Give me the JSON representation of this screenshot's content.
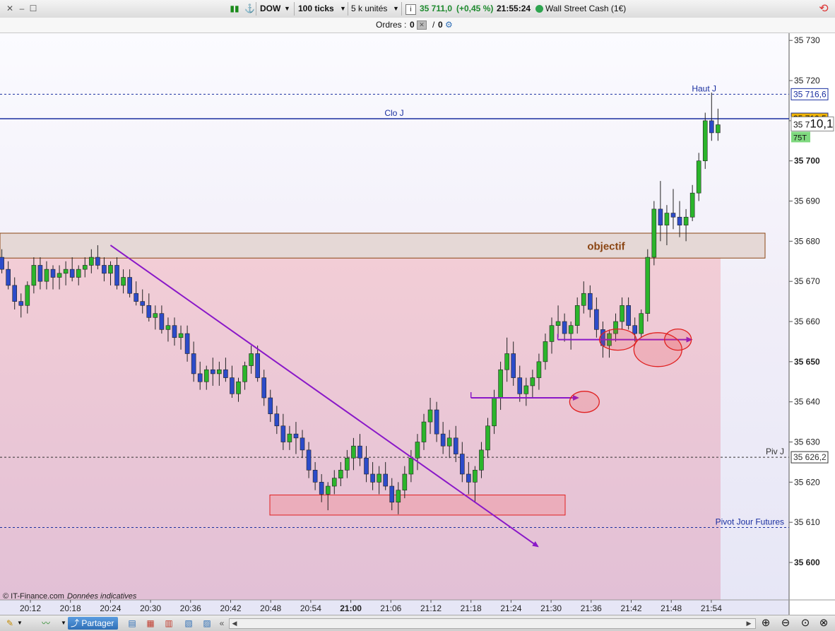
{
  "toolbar": {
    "symbol": "DOW",
    "interval": "100 ticks",
    "size": "5 k unités",
    "info_icon": "info-icon",
    "price": "35 711,0",
    "change": "(+0,45 %)",
    "time": "21:55:24",
    "instrument": "Wall Street Cash (1€)",
    "status_color": "#2ea44f"
  },
  "orders": {
    "label": "Ordres :",
    "count1": "0",
    "slash": "/",
    "count2": "0"
  },
  "footer": {
    "copyright": "© IT-Finance.com",
    "disclaimer": "Données indicatives",
    "share_label": "Partager"
  },
  "chart_data": {
    "type": "candlestick",
    "title": "",
    "ylim": [
      35592,
      35733
    ],
    "y_ticks": [
      35600,
      35610,
      35620,
      35630,
      35640,
      35650,
      35660,
      35670,
      35680,
      35690,
      35700,
      35710,
      35720,
      35730
    ],
    "y_tick_labels": [
      "35 600",
      "35 610",
      "35 620",
      "35 630",
      "35 640",
      "35 650",
      "35 660",
      "35 670",
      "35 680",
      "35 690",
      "35 700",
      "35 710",
      "35 720",
      "35 730"
    ],
    "bold_y_ticks": [
      35600,
      35650,
      35700
    ],
    "x_tick_labels": [
      "20:12",
      "20:18",
      "20:24",
      "20:30",
      "20:36",
      "20:42",
      "20:48",
      "20:54",
      "21:00",
      "21:06",
      "21:12",
      "21:18",
      "21:24",
      "21:30",
      "21:36",
      "21:42",
      "21:48",
      "21:54"
    ],
    "bold_x_tick": "21:00",
    "up_color": "#2bb52b",
    "down_color": "#2c4bc9",
    "levels": [
      {
        "name": "Haut J",
        "value": 35716.6,
        "label": "35 716,6",
        "style": "dashed",
        "color": "#1a2fa0"
      },
      {
        "name": "Clo J",
        "value": 35710.5,
        "label": "35 710,5",
        "style": "solid",
        "color": "#1a2fa0",
        "badge": "#f0b400"
      },
      {
        "name": "Piv J",
        "value": 35626.2,
        "label": "35 626,2",
        "style": "dashed",
        "color": "#333333"
      },
      {
        "name": "Pivot Jour Futures",
        "value": 35608.7,
        "label": "",
        "style": "dashed",
        "color": "#1a2fa0"
      }
    ],
    "current_price": {
      "text_small": "35 7",
      "text_big": "10,1",
      "value": 35709.2
    },
    "tick_count_label": "75T",
    "zone_objectif": {
      "label": "objectif",
      "y_top": 35682,
      "y_bottom": 35675.8
    },
    "support_zone": {
      "y_top": 35616.8,
      "y_bottom": 35611.8
    },
    "trendline": {
      "from": {
        "x": "20:24",
        "y": 35679
      },
      "to": {
        "x": "21:28",
        "y": 35604
      }
    },
    "arrows": [
      {
        "from": {
          "x": "21:18",
          "y": 35641
        },
        "to": {
          "x": "21:34",
          "y": 35641
        }
      },
      {
        "from": {
          "x": "21:31",
          "y": 35655.5
        },
        "to": {
          "x": "21:51",
          "y": 35655.5
        }
      }
    ],
    "circles": [
      {
        "x": "21:35",
        "y": 35640
      },
      {
        "x": "21:40",
        "y": 35655.5
      },
      {
        "x": "21:46",
        "y": 35653
      },
      {
        "x": "21:49",
        "y": 35655.5
      }
    ],
    "candles": [
      {
        "o": 35674.5,
        "h": 35677,
        "l": 35672,
        "c": 35673,
        "x": "20:06"
      },
      {
        "o": 35673,
        "h": 35676,
        "l": 35671,
        "c": 35675,
        "x": "20:06"
      },
      {
        "o": 35675,
        "h": 35678,
        "l": 35672,
        "c": 35676,
        "x": "20:07"
      },
      {
        "o": 35676,
        "h": 35679,
        "l": 35674,
        "c": 35677,
        "x": "20:07"
      },
      {
        "o": 35677,
        "h": 35679,
        "l": 35673,
        "c": 35674,
        "x": "20:08"
      },
      {
        "o": 35674,
        "h": 35677,
        "l": 35671,
        "c": 35676,
        "x": "20:08"
      },
      {
        "o": 35676,
        "h": 35678,
        "l": 35672,
        "c": 35673,
        "x": "20:09"
      },
      {
        "o": 35673,
        "h": 35675,
        "l": 35668,
        "c": 35669,
        "x": "20:09"
      },
      {
        "o": 35669,
        "h": 35671,
        "l": 35663,
        "c": 35665,
        "x": "20:10"
      },
      {
        "o": 35665,
        "h": 35667,
        "l": 35661,
        "c": 35664,
        "x": "20:10"
      },
      {
        "o": 35664,
        "h": 35670,
        "l": 35662,
        "c": 35669,
        "x": "20:11"
      },
      {
        "o": 35669,
        "h": 35676,
        "l": 35667,
        "c": 35674,
        "x": "20:12"
      },
      {
        "o": 35674,
        "h": 35676,
        "l": 35668,
        "c": 35670,
        "x": "20:12"
      },
      {
        "o": 35670,
        "h": 35675,
        "l": 35668,
        "c": 35673,
        "x": "20:13"
      },
      {
        "o": 35673,
        "h": 35674,
        "l": 35668,
        "c": 35671,
        "x": "20:14"
      },
      {
        "o": 35671,
        "h": 35674,
        "l": 35668,
        "c": 35672,
        "x": "20:15"
      },
      {
        "o": 35672,
        "h": 35675,
        "l": 35669,
        "c": 35673,
        "x": "20:16"
      },
      {
        "o": 35673,
        "h": 35676,
        "l": 35670,
        "c": 35671,
        "x": "20:17"
      },
      {
        "o": 35671,
        "h": 35674,
        "l": 35669,
        "c": 35673,
        "x": "20:18"
      },
      {
        "o": 35673,
        "h": 35676,
        "l": 35671,
        "c": 35674,
        "x": "20:19"
      },
      {
        "o": 35674,
        "h": 35678,
        "l": 35672,
        "c": 35676,
        "x": "20:20"
      },
      {
        "o": 35676,
        "h": 35679,
        "l": 35673,
        "c": 35674,
        "x": "20:21"
      },
      {
        "o": 35674,
        "h": 35676,
        "l": 35670,
        "c": 35672,
        "x": "20:22"
      },
      {
        "o": 35672,
        "h": 35675,
        "l": 35669,
        "c": 35674,
        "x": "20:23"
      },
      {
        "o": 35674,
        "h": 35676,
        "l": 35668,
        "c": 35669,
        "x": "20:24"
      },
      {
        "o": 35669,
        "h": 35673,
        "l": 35667,
        "c": 35671,
        "x": "20:25"
      },
      {
        "o": 35671,
        "h": 35673,
        "l": 35666,
        "c": 35667,
        "x": "20:26"
      },
      {
        "o": 35667,
        "h": 35670,
        "l": 35664,
        "c": 35665,
        "x": "20:27"
      },
      {
        "o": 35665,
        "h": 35668,
        "l": 35662,
        "c": 35664,
        "x": "20:28"
      },
      {
        "o": 35664,
        "h": 35667,
        "l": 35660,
        "c": 35661,
        "x": "20:29"
      },
      {
        "o": 35661,
        "h": 35664,
        "l": 35658,
        "c": 35662,
        "x": "20:30"
      },
      {
        "o": 35662,
        "h": 35664,
        "l": 35657,
        "c": 35658,
        "x": "20:31"
      },
      {
        "o": 35658,
        "h": 35661,
        "l": 35655,
        "c": 35659,
        "x": "20:32"
      },
      {
        "o": 35659,
        "h": 35661,
        "l": 35654,
        "c": 35656,
        "x": "20:33"
      },
      {
        "o": 35656,
        "h": 35659,
        "l": 35653,
        "c": 35657,
        "x": "20:34"
      },
      {
        "o": 35657,
        "h": 35659,
        "l": 35650,
        "c": 35652,
        "x": "20:35"
      },
      {
        "o": 35652,
        "h": 35655,
        "l": 35645,
        "c": 35647,
        "x": "20:36"
      },
      {
        "o": 35647,
        "h": 35650,
        "l": 35643,
        "c": 35645,
        "x": "20:37"
      },
      {
        "o": 35645,
        "h": 35649,
        "l": 35643,
        "c": 35648,
        "x": "20:38"
      },
      {
        "o": 35648,
        "h": 35651,
        "l": 35644,
        "c": 35647,
        "x": "20:39"
      },
      {
        "o": 35647,
        "h": 35650,
        "l": 35644,
        "c": 35648,
        "x": "20:40"
      },
      {
        "o": 35648,
        "h": 35651,
        "l": 35645,
        "c": 35646,
        "x": "20:41"
      },
      {
        "o": 35646,
        "h": 35649,
        "l": 35641,
        "c": 35642,
        "x": "20:42"
      },
      {
        "o": 35642,
        "h": 35646,
        "l": 35640,
        "c": 35645,
        "x": "20:43"
      },
      {
        "o": 35645,
        "h": 35650,
        "l": 35643,
        "c": 35649,
        "x": "20:44"
      },
      {
        "o": 35649,
        "h": 35654,
        "l": 35647,
        "c": 35652,
        "x": "20:45"
      },
      {
        "o": 35652,
        "h": 35654,
        "l": 35645,
        "c": 35646,
        "x": "20:46"
      },
      {
        "o": 35646,
        "h": 35648,
        "l": 35639,
        "c": 35641,
        "x": "20:47"
      },
      {
        "o": 35641,
        "h": 35643,
        "l": 35635,
        "c": 35637,
        "x": "20:48"
      },
      {
        "o": 35637,
        "h": 35639,
        "l": 35632,
        "c": 35634,
        "x": "20:49"
      },
      {
        "o": 35634,
        "h": 35637,
        "l": 35628,
        "c": 35630,
        "x": "20:50"
      },
      {
        "o": 35630,
        "h": 35634,
        "l": 35628,
        "c": 35632,
        "x": "20:51"
      },
      {
        "o": 35632,
        "h": 35635,
        "l": 35627,
        "c": 35631,
        "x": "20:52"
      },
      {
        "o": 35631,
        "h": 35633,
        "l": 35626,
        "c": 35628,
        "x": "20:53"
      },
      {
        "o": 35628,
        "h": 35630,
        "l": 35621,
        "c": 35623,
        "x": "20:54"
      },
      {
        "o": 35623,
        "h": 35625,
        "l": 35618,
        "c": 35620,
        "x": "20:55"
      },
      {
        "o": 35620,
        "h": 35622,
        "l": 35615,
        "c": 35617,
        "x": "20:56"
      },
      {
        "o": 35617,
        "h": 35620,
        "l": 35613,
        "c": 35619,
        "x": "20:57"
      },
      {
        "o": 35619,
        "h": 35623,
        "l": 35617,
        "c": 35621,
        "x": "20:58"
      },
      {
        "o": 35621,
        "h": 35625,
        "l": 35619,
        "c": 35623,
        "x": "20:59"
      },
      {
        "o": 35623,
        "h": 35628,
        "l": 35621,
        "c": 35626,
        "x": "21:00"
      },
      {
        "o": 35626,
        "h": 35631,
        "l": 35623,
        "c": 35629,
        "x": "21:01"
      },
      {
        "o": 35629,
        "h": 35632,
        "l": 35624,
        "c": 35626,
        "x": "21:02"
      },
      {
        "o": 35626,
        "h": 35629,
        "l": 35620,
        "c": 35622,
        "x": "21:03"
      },
      {
        "o": 35622,
        "h": 35625,
        "l": 35618,
        "c": 35620,
        "x": "21:04"
      },
      {
        "o": 35620,
        "h": 35624,
        "l": 35617,
        "c": 35622,
        "x": "21:05"
      },
      {
        "o": 35622,
        "h": 35625,
        "l": 35618,
        "c": 35619,
        "x": "21:06"
      },
      {
        "o": 35619,
        "h": 35621,
        "l": 35613,
        "c": 35615,
        "x": "21:07"
      },
      {
        "o": 35615,
        "h": 35620,
        "l": 35612,
        "c": 35618,
        "x": "21:08"
      },
      {
        "o": 35618,
        "h": 35624,
        "l": 35616,
        "c": 35622,
        "x": "21:09"
      },
      {
        "o": 35622,
        "h": 35628,
        "l": 35620,
        "c": 35626,
        "x": "21:10"
      },
      {
        "o": 35626,
        "h": 35632,
        "l": 35623,
        "c": 35630,
        "x": "21:11"
      },
      {
        "o": 35630,
        "h": 35637,
        "l": 35628,
        "c": 35635,
        "x": "21:12"
      },
      {
        "o": 35635,
        "h": 35641,
        "l": 35632,
        "c": 35638,
        "x": "21:13"
      },
      {
        "o": 35638,
        "h": 35640,
        "l": 35630,
        "c": 35632,
        "x": "21:14"
      },
      {
        "o": 35632,
        "h": 35635,
        "l": 35627,
        "c": 35629,
        "x": "21:15"
      },
      {
        "o": 35629,
        "h": 35633,
        "l": 35626,
        "c": 35631,
        "x": "21:16"
      },
      {
        "o": 35631,
        "h": 35634,
        "l": 35625,
        "c": 35627,
        "x": "21:17"
      },
      {
        "o": 35627,
        "h": 35630,
        "l": 35620,
        "c": 35622,
        "x": "21:18"
      },
      {
        "o": 35622,
        "h": 35625,
        "l": 35617,
        "c": 35620,
        "x": "21:19"
      },
      {
        "o": 35620,
        "h": 35624,
        "l": 35615,
        "c": 35623,
        "x": "21:20"
      },
      {
        "o": 35623,
        "h": 35630,
        "l": 35621,
        "c": 35628,
        "x": "21:21"
      },
      {
        "o": 35628,
        "h": 35636,
        "l": 35626,
        "c": 35634,
        "x": "21:22"
      },
      {
        "o": 35634,
        "h": 35643,
        "l": 35632,
        "c": 35641,
        "x": "21:23"
      },
      {
        "o": 35641,
        "h": 35650,
        "l": 35638,
        "c": 35648,
        "x": "21:24"
      },
      {
        "o": 35648,
        "h": 35656,
        "l": 35645,
        "c": 35652,
        "x": "21:25"
      },
      {
        "o": 35652,
        "h": 35655,
        "l": 35644,
        "c": 35646,
        "x": "21:26"
      },
      {
        "o": 35646,
        "h": 35649,
        "l": 35640,
        "c": 35642,
        "x": "21:27"
      },
      {
        "o": 35642,
        "h": 35646,
        "l": 35639,
        "c": 35644,
        "x": "21:28"
      },
      {
        "o": 35644,
        "h": 35648,
        "l": 35641,
        "c": 35646,
        "x": "21:29"
      },
      {
        "o": 35646,
        "h": 35652,
        "l": 35643,
        "c": 35650,
        "x": "21:30"
      },
      {
        "o": 35650,
        "h": 35657,
        "l": 35648,
        "c": 35655,
        "x": "21:31"
      },
      {
        "o": 35655,
        "h": 35661,
        "l": 35652,
        "c": 35659,
        "x": "21:32"
      },
      {
        "o": 35659,
        "h": 35664,
        "l": 35656,
        "c": 35660,
        "x": "21:33"
      },
      {
        "o": 35660,
        "h": 35662,
        "l": 35655,
        "c": 35657,
        "x": "21:34"
      },
      {
        "o": 35657,
        "h": 35660,
        "l": 35653,
        "c": 35659,
        "x": "21:35"
      },
      {
        "o": 35659,
        "h": 35666,
        "l": 35657,
        "c": 35664,
        "x": "21:36"
      },
      {
        "o": 35664,
        "h": 35670,
        "l": 35662,
        "c": 35667,
        "x": "21:37"
      },
      {
        "o": 35667,
        "h": 35669,
        "l": 35661,
        "c": 35663,
        "x": "21:38"
      },
      {
        "o": 35663,
        "h": 35666,
        "l": 35656,
        "c": 35658,
        "x": "21:39"
      },
      {
        "o": 35658,
        "h": 35660,
        "l": 35651,
        "c": 35654,
        "x": "21:40"
      },
      {
        "o": 35654,
        "h": 35658,
        "l": 35651,
        "c": 35657,
        "x": "21:41"
      },
      {
        "o": 35657,
        "h": 35662,
        "l": 35655,
        "c": 35660,
        "x": "21:42"
      },
      {
        "o": 35660,
        "h": 35666,
        "l": 35658,
        "c": 35664,
        "x": "21:43"
      },
      {
        "o": 35664,
        "h": 35666,
        "l": 35658,
        "c": 35659,
        "x": "21:44"
      },
      {
        "o": 35659,
        "h": 35661,
        "l": 35655,
        "c": 35657,
        "x": "21:45"
      },
      {
        "o": 35657,
        "h": 35663,
        "l": 35656,
        "c": 35662,
        "x": "21:46"
      },
      {
        "o": 35662,
        "h": 35678,
        "l": 35660,
        "c": 35676,
        "x": "21:46"
      },
      {
        "o": 35676,
        "h": 35690,
        "l": 35674,
        "c": 35688,
        "x": "21:47"
      },
      {
        "o": 35688,
        "h": 35695,
        "l": 35680,
        "c": 35684,
        "x": "21:48"
      },
      {
        "o": 35684,
        "h": 35689,
        "l": 35679,
        "c": 35687,
        "x": "21:49"
      },
      {
        "o": 35687,
        "h": 35693,
        "l": 35683,
        "c": 35686,
        "x": "21:50"
      },
      {
        "o": 35686,
        "h": 35690,
        "l": 35681,
        "c": 35684,
        "x": "21:51"
      },
      {
        "o": 35684,
        "h": 35688,
        "l": 35680,
        "c": 35686,
        "x": "21:52"
      },
      {
        "o": 35686,
        "h": 35694,
        "l": 35685,
        "c": 35692,
        "x": "21:53"
      },
      {
        "o": 35692,
        "h": 35702,
        "l": 35690,
        "c": 35700,
        "x": "21:53"
      },
      {
        "o": 35700,
        "h": 35712,
        "l": 35698,
        "c": 35710,
        "x": "21:54"
      },
      {
        "o": 35710,
        "h": 35717,
        "l": 35705,
        "c": 35707,
        "x": "21:54"
      },
      {
        "o": 35707,
        "h": 35713,
        "l": 35705,
        "c": 35709,
        "x": "21:55"
      }
    ]
  }
}
